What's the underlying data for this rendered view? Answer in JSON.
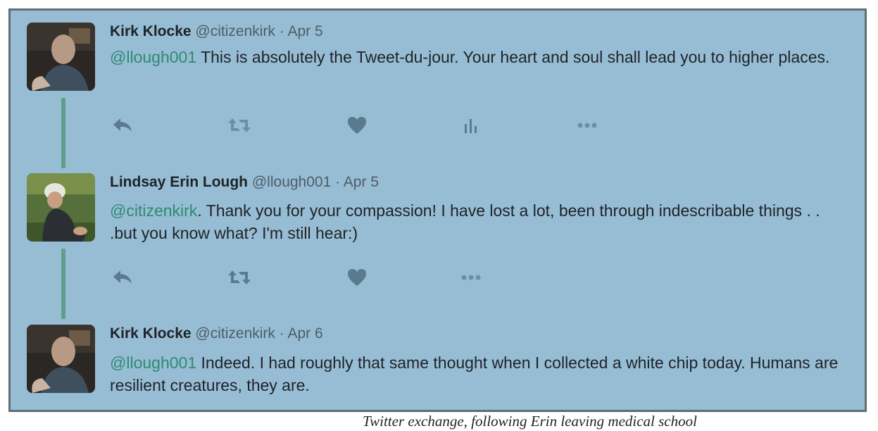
{
  "tweets": [
    {
      "name": "Kirk Klocke",
      "handle": "@citizenkirk",
      "separator": "·",
      "date": "Apr 5",
      "mention": "@llough001",
      "text": " This is absolutely the Tweet-du-jour. Your heart and soul shall lead you to higher places.",
      "avatar_icon": "man-portrait-icon",
      "actions": [
        "reply-icon",
        "retweet-icon",
        "like-icon",
        "analytics-icon",
        "more-icon"
      ]
    },
    {
      "name": "Lindsay Erin Lough",
      "handle": "@llough001",
      "separator": "·",
      "date": "Apr 5",
      "mention": "@citizenkirk",
      "text": ". Thank you for your compassion!  I have lost a lot, been through indescribable things . . .but you know what? I'm still hear:)",
      "avatar_icon": "woman-portrait-icon",
      "actions": [
        "reply-icon",
        "retweet-icon",
        "like-icon",
        "more-icon"
      ]
    },
    {
      "name": "Kirk Klocke",
      "handle": "@citizenkirk",
      "separator": "·",
      "date": "Apr 6",
      "mention": "@llough001",
      "text": " Indeed. I had roughly that same thought when I collected a white chip today. Humans are resilient creatures, they are.",
      "avatar_icon": "man-portrait-icon",
      "actions": []
    }
  ],
  "caption": "Twitter exchange, following Erin leaving medical school",
  "colors": {
    "background": "#97bdd5",
    "border": "#5e6f73",
    "mention": "#2f8a70",
    "thread_line": "#5e9e8a",
    "icon": "#5a7b8f"
  }
}
